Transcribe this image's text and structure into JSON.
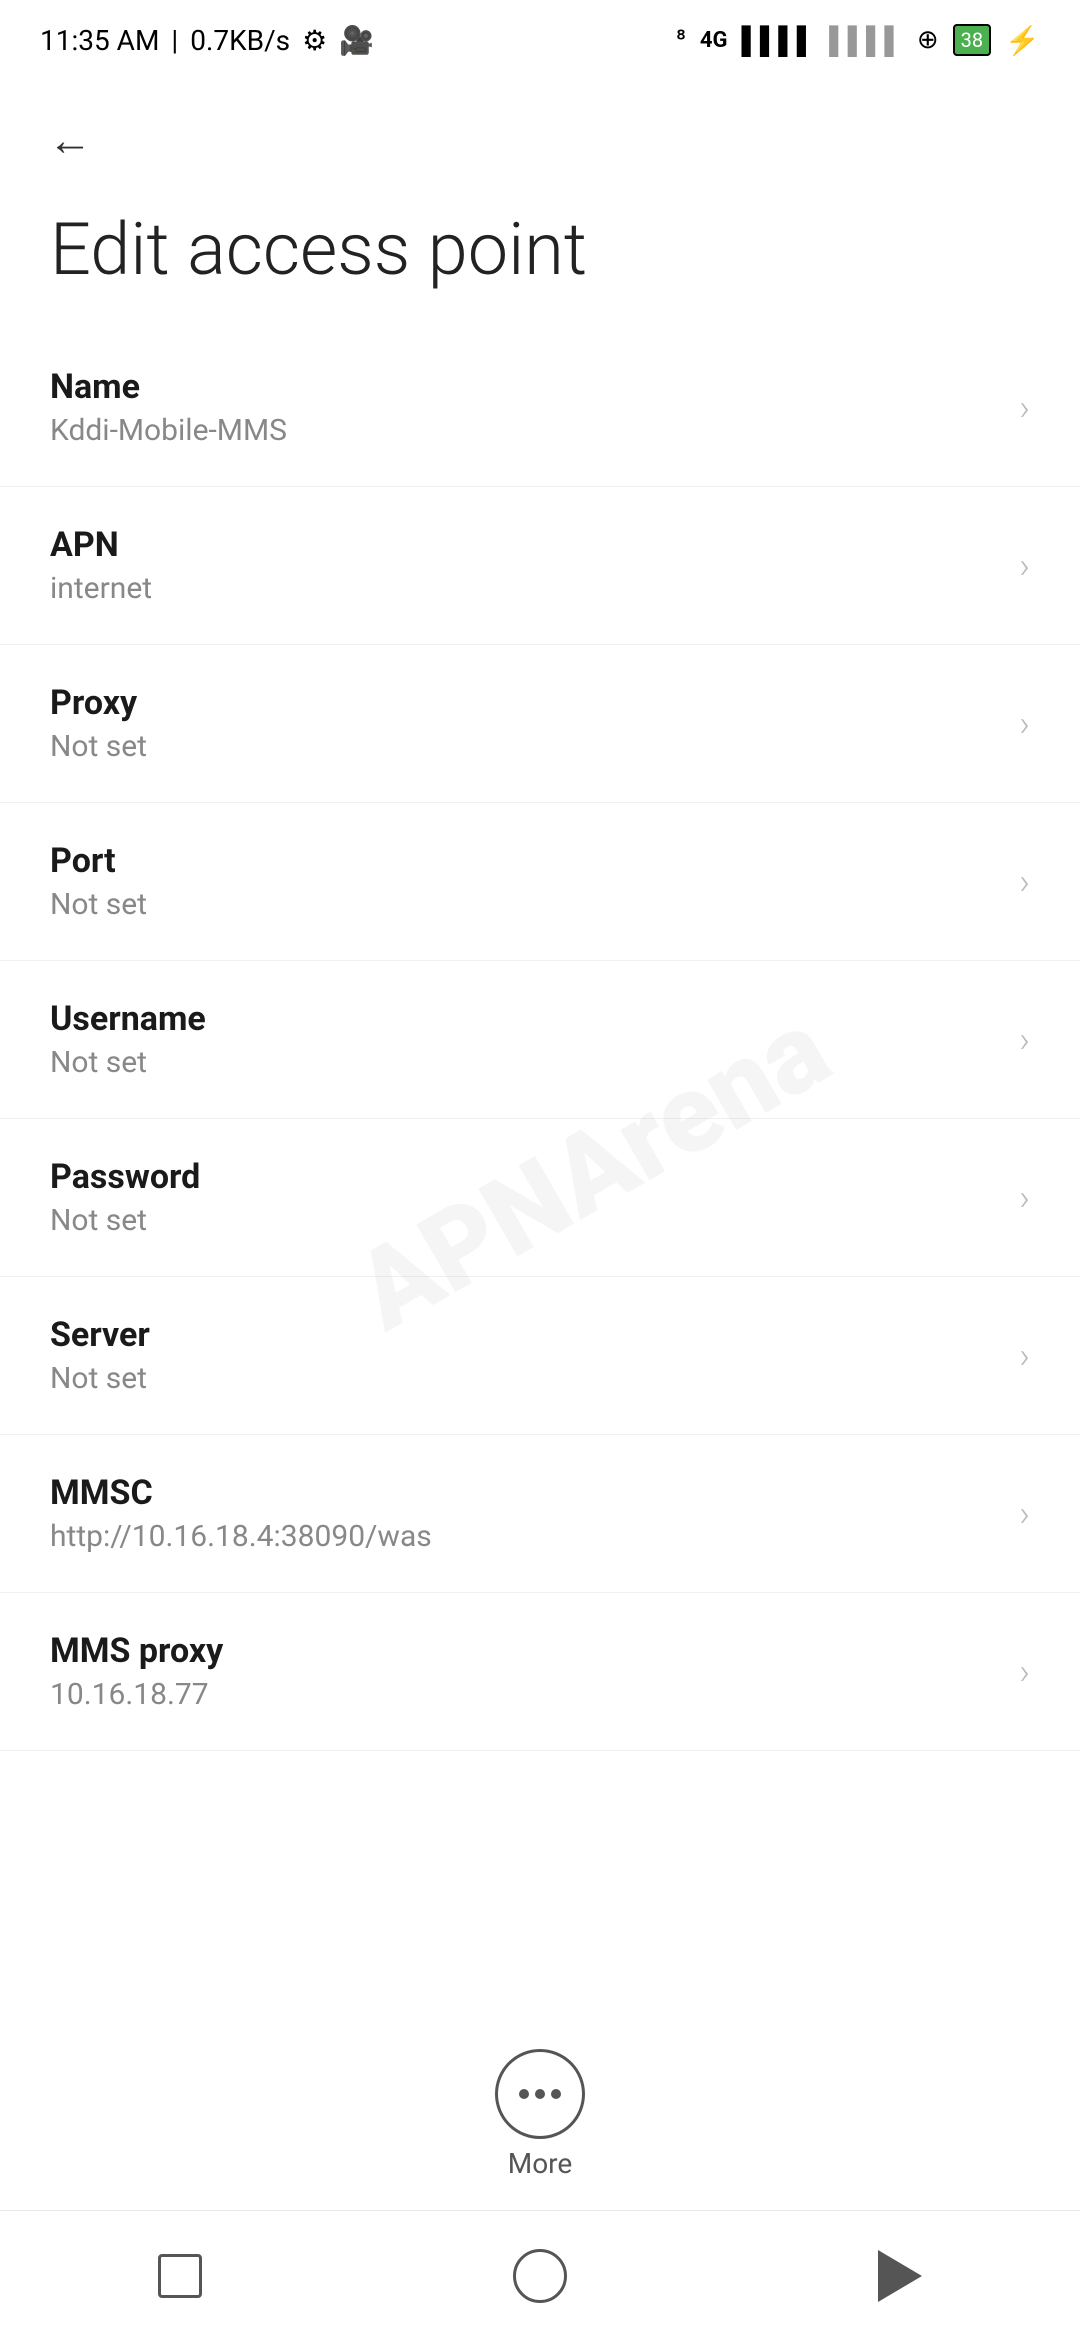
{
  "statusBar": {
    "time": "11:35 AM",
    "speed": "0.7KB/s",
    "battery": "38"
  },
  "nav": {
    "backLabel": "←"
  },
  "page": {
    "title": "Edit access point"
  },
  "fields": [
    {
      "label": "Name",
      "value": "Kddi-Mobile-MMS"
    },
    {
      "label": "APN",
      "value": "internet"
    },
    {
      "label": "Proxy",
      "value": "Not set"
    },
    {
      "label": "Port",
      "value": "Not set"
    },
    {
      "label": "Username",
      "value": "Not set"
    },
    {
      "label": "Password",
      "value": "Not set"
    },
    {
      "label": "Server",
      "value": "Not set"
    },
    {
      "label": "MMSC",
      "value": "http://10.16.18.4:38090/was"
    },
    {
      "label": "MMS proxy",
      "value": "10.16.18.77"
    }
  ],
  "more": {
    "label": "More"
  },
  "watermark": "APNArena"
}
